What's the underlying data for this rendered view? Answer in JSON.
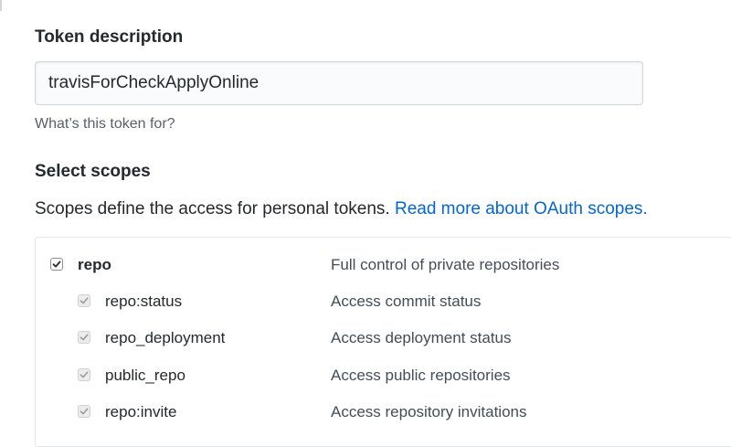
{
  "token_description": {
    "title": "Token description",
    "input_value": "travisForCheckApplyOnline",
    "hint": "What’s this token for?"
  },
  "scopes": {
    "title": "Select scopes",
    "intro": "Scopes define the access for personal tokens.",
    "link_text": "Read more about OAuth scopes.",
    "parent": {
      "name": "repo",
      "description": "Full control of private repositories",
      "checked": true
    },
    "children": [
      {
        "name": "repo:status",
        "description": "Access commit status",
        "checked": true
      },
      {
        "name": "repo_deployment",
        "description": "Access deployment status",
        "checked": true
      },
      {
        "name": "public_repo",
        "description": "Access public repositories",
        "checked": true
      },
      {
        "name": "repo:invite",
        "description": "Access repository invitations",
        "checked": true
      }
    ]
  },
  "colors": {
    "link": "#0366d6",
    "muted_text": "#586069",
    "border": "#e1e4e8"
  }
}
